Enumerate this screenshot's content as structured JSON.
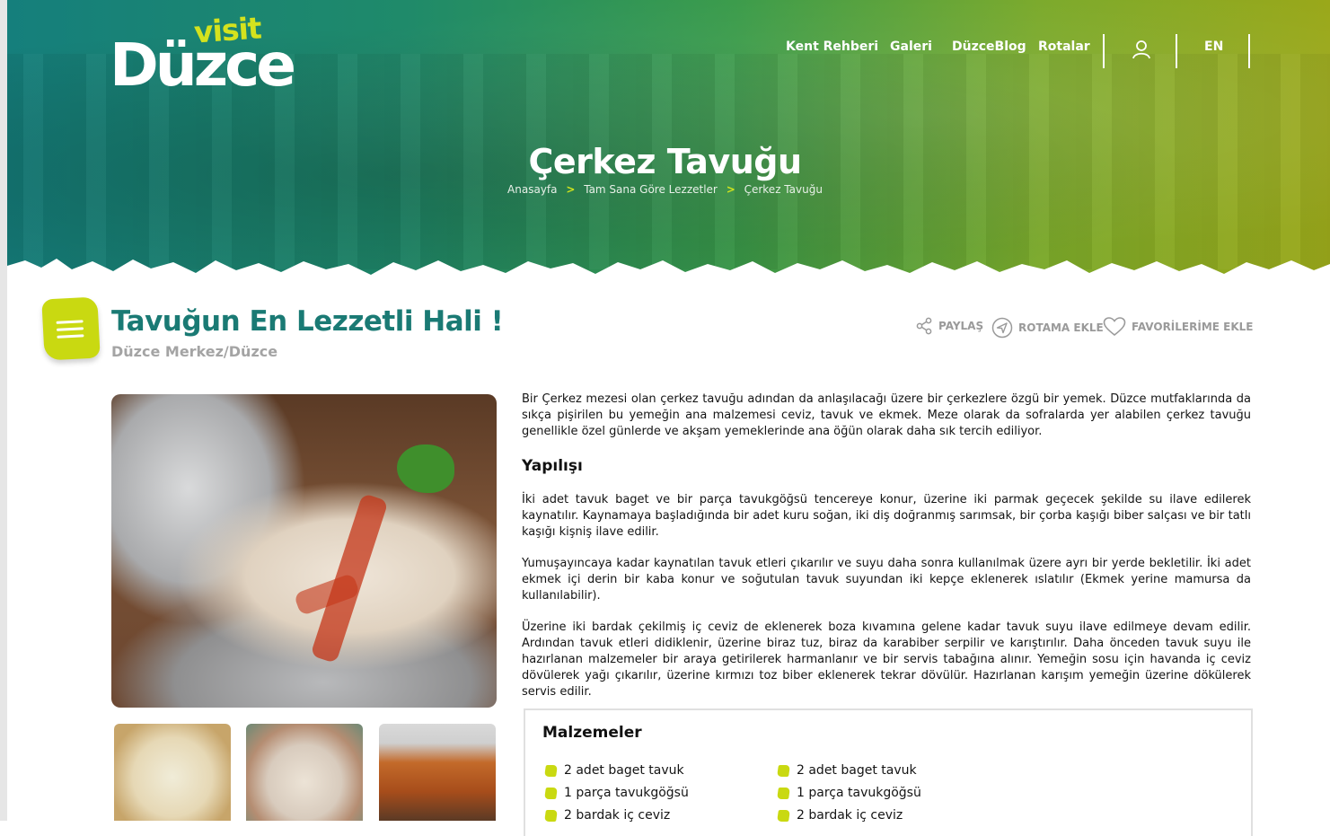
{
  "brand": {
    "logo_top": "visit",
    "logo_main": "Düzce"
  },
  "nav": {
    "items": [
      "Kent Rehberi",
      "Galeri",
      "DüzceBlog",
      "Rotalar"
    ],
    "lang": "EN"
  },
  "hero": {
    "title": "Çerkez Tavuğu",
    "breadcrumb": [
      "Anasayfa",
      "Tam Sana Göre Lezzetler",
      "Çerkez Tavuğu"
    ]
  },
  "header": {
    "title": "Tavuğun En Lezzetli Hali !",
    "location": "Düzce Merkez/Düzce",
    "actions": {
      "share": "PAYLAŞ",
      "route": "ROTAMA EKLE",
      "fav": "FAVORİLERİME EKLE"
    }
  },
  "content": {
    "intro": "Bir Çerkez mezesi olan çerkez tavuğu adından da anlaşılacağı üzere bir çerkezlere özgü bir yemek. Düzce mutfaklarında da sıkça pişirilen bu yemeğin ana malzemesi ceviz, tavuk ve ekmek. Meze olarak da sofralarda yer alabilen çerkez tavuğu genellikle özel günlerde ve akşam yemeklerinde ana öğün olarak daha sık tercih ediliyor.",
    "heading": "Yapılışı",
    "p1": "İki adet tavuk baget ve bir parça tavukgöğsü tencereye konur, üzerine iki parmak geçecek şekilde su ilave edilerek kaynatılır. Kaynamaya başladığında bir adet kuru soğan, iki diş doğranmış sarımsak, bir çorba kaşığı biber salçası ve bir tatlı kaşığı kişniş ilave edilir.",
    "p2": "Yumuşayıncaya kadar kaynatılan tavuk etleri çıkarılır ve suyu daha sonra kullanılmak üzere ayrı bir yerde bekletilir. İki adet ekmek içi derin bir kaba konur ve soğutulan tavuk suyundan iki kepçe eklenerek ıslatılır (Ekmek yerine mamursa da kullanılabilir).",
    "p3": "Üzerine iki bardak çekilmiş iç ceviz de eklenerek boza kıvamına gelene kadar tavuk suyu ilave edilmeye devam edilir. Ardından tavuk etleri didiklenir, üzerine biraz tuz, biraz da karabiber serpilir ve karıştırılır. Daha önceden tavuk suyu ile hazırlanan malzemeler bir araya getirilerek harmanlanır ve bir servis tabağına alınır. Yemeğin sosu için havanda iç ceviz dövülerek yağı çıkarılır, üzerine kırmızı toz biber eklenerek tekrar dövülür. Hazırlanan karışım yemeğin üzerine dökülerek servis edilir."
  },
  "ingredients": {
    "title": "Malzemeler",
    "col1": [
      "2 adet baget tavuk",
      "1 parça tavukgöğsü",
      "2 bardak iç ceviz"
    ],
    "col2": [
      "2 adet baget tavuk",
      "1 parça tavukgöğsü",
      "2 bardak iç ceviz"
    ]
  },
  "colors": {
    "accent": "#c9d911",
    "title": "#1a7a74",
    "muted": "#9a9a9a"
  }
}
